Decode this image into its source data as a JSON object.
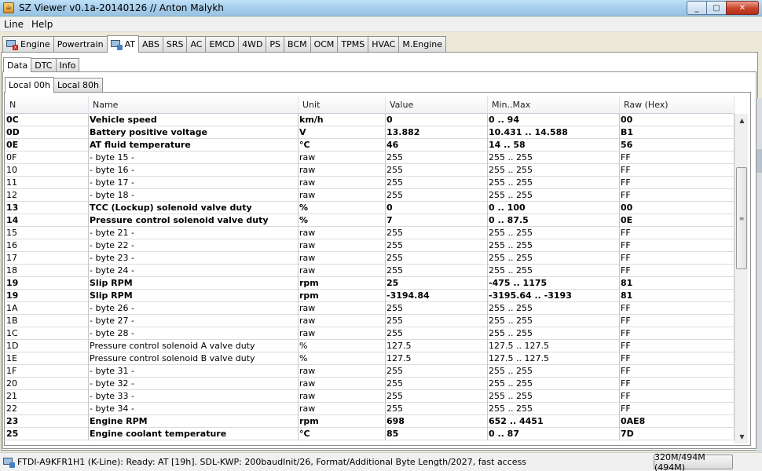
{
  "window": {
    "title": "SZ Viewer v0.1a-20140126 // Anton Malykh",
    "minimize_label": "_",
    "maximize_label": "▢",
    "close_label": "✕"
  },
  "menu": {
    "items": [
      "Line",
      "Help"
    ]
  },
  "top_tabs": [
    {
      "label": "Engine",
      "icon": "monitor-error-icon"
    },
    {
      "label": "Powertrain"
    },
    {
      "label": "AT",
      "icon": "monitor-icon",
      "selected": true
    },
    {
      "label": "ABS"
    },
    {
      "label": "SRS"
    },
    {
      "label": "AC"
    },
    {
      "label": "EMCD"
    },
    {
      "label": "4WD"
    },
    {
      "label": "PS"
    },
    {
      "label": "BCM"
    },
    {
      "label": "OCM"
    },
    {
      "label": "TPMS"
    },
    {
      "label": "HVAC"
    },
    {
      "label": "M.Engine"
    }
  ],
  "sub_tabs": [
    {
      "label": "Data",
      "selected": true
    },
    {
      "label": "DTC"
    },
    {
      "label": "Info"
    }
  ],
  "local_tabs": [
    {
      "label": "Local 00h",
      "selected": true
    },
    {
      "label": "Local 80h"
    }
  ],
  "table": {
    "columns": [
      "N",
      "Name",
      "Unit",
      "Value",
      "Min..Max",
      "Raw (Hex)"
    ],
    "rows": [
      {
        "n": "0C",
        "name": "Vehicle speed",
        "unit": "km/h",
        "value": "0",
        "minmax": "0 .. 94",
        "raw": "00",
        "bold": true
      },
      {
        "n": "0D",
        "name": "Battery positive voltage",
        "unit": "V",
        "value": "13.882",
        "minmax": "10.431 .. 14.588",
        "raw": "B1",
        "bold": true
      },
      {
        "n": "0E",
        "name": "AT fluid temperature",
        "unit": "°C",
        "value": "46",
        "minmax": "14 .. 58",
        "raw": "56",
        "bold": true
      },
      {
        "n": "0F",
        "name": "- byte 15 -",
        "unit": "raw",
        "value": "255",
        "minmax": "255 .. 255",
        "raw": "FF"
      },
      {
        "n": "10",
        "name": "- byte 16 -",
        "unit": "raw",
        "value": "255",
        "minmax": "255 .. 255",
        "raw": "FF"
      },
      {
        "n": "11",
        "name": "- byte 17 -",
        "unit": "raw",
        "value": "255",
        "minmax": "255 .. 255",
        "raw": "FF"
      },
      {
        "n": "12",
        "name": "- byte 18 -",
        "unit": "raw",
        "value": "255",
        "minmax": "255 .. 255",
        "raw": "FF"
      },
      {
        "n": "13",
        "name": "TCC (Lockup) solenoid valve duty",
        "unit": "%",
        "value": "0",
        "minmax": "0 .. 100",
        "raw": "00",
        "bold": true
      },
      {
        "n": "14",
        "name": "Pressure control solenoid valve duty",
        "unit": "%",
        "value": "7",
        "minmax": "0 .. 87.5",
        "raw": "0E",
        "bold": true
      },
      {
        "n": "15",
        "name": "- byte 21 -",
        "unit": "raw",
        "value": "255",
        "minmax": "255 .. 255",
        "raw": "FF"
      },
      {
        "n": "16",
        "name": "- byte 22 -",
        "unit": "raw",
        "value": "255",
        "minmax": "255 .. 255",
        "raw": "FF"
      },
      {
        "n": "17",
        "name": "- byte 23 -",
        "unit": "raw",
        "value": "255",
        "minmax": "255 .. 255",
        "raw": "FF"
      },
      {
        "n": "18",
        "name": "- byte 24 -",
        "unit": "raw",
        "value": "255",
        "minmax": "255 .. 255",
        "raw": "FF"
      },
      {
        "n": "19",
        "name": "Slip RPM",
        "unit": "rpm",
        "value": "25",
        "minmax": "-475 .. 1175",
        "raw": "81",
        "bold": true
      },
      {
        "n": "19",
        "name": "Slip RPM",
        "unit": "rpm",
        "value": "-3194.84",
        "minmax": "-3195.64 .. -3193",
        "raw": "81",
        "bold": true
      },
      {
        "n": "1A",
        "name": "- byte 26 -",
        "unit": "raw",
        "value": "255",
        "minmax": "255 .. 255",
        "raw": "FF"
      },
      {
        "n": "1B",
        "name": "- byte 27 -",
        "unit": "raw",
        "value": "255",
        "minmax": "255 .. 255",
        "raw": "FF"
      },
      {
        "n": "1C",
        "name": "- byte 28 -",
        "unit": "raw",
        "value": "255",
        "minmax": "255 .. 255",
        "raw": "FF"
      },
      {
        "n": "1D",
        "name": "Pressure control solenoid A valve duty",
        "unit": "%",
        "value": "127.5",
        "minmax": "127.5 .. 127.5",
        "raw": "FF"
      },
      {
        "n": "1E",
        "name": "Pressure control solenoid B valve duty",
        "unit": "%",
        "value": "127.5",
        "minmax": "127.5 .. 127.5",
        "raw": "FF"
      },
      {
        "n": "1F",
        "name": "- byte 31 -",
        "unit": "raw",
        "value": "255",
        "minmax": "255 .. 255",
        "raw": "FF"
      },
      {
        "n": "20",
        "name": "- byte 32 -",
        "unit": "raw",
        "value": "255",
        "minmax": "255 .. 255",
        "raw": "FF"
      },
      {
        "n": "21",
        "name": "- byte 33 -",
        "unit": "raw",
        "value": "255",
        "minmax": "255 .. 255",
        "raw": "FF"
      },
      {
        "n": "22",
        "name": "- byte 34 -",
        "unit": "raw",
        "value": "255",
        "minmax": "255 .. 255",
        "raw": "FF"
      },
      {
        "n": "23",
        "name": "Engine RPM",
        "unit": "rpm",
        "value": "698",
        "minmax": "652 .. 4451",
        "raw": "0AE8",
        "bold": true
      },
      {
        "n": "25",
        "name": "Engine coolant temperature",
        "unit": "°C",
        "value": "85",
        "minmax": "0 .. 87",
        "raw": "7D",
        "bold": true
      }
    ]
  },
  "status": {
    "text": "FTDI-A9KFR1H1 (K-Line): Ready: AT [19h]. SDL-KWP: 200baudInit/26, Format/Additional Byte Length/2027, fast access",
    "memory": "320M/494M (494M)"
  }
}
